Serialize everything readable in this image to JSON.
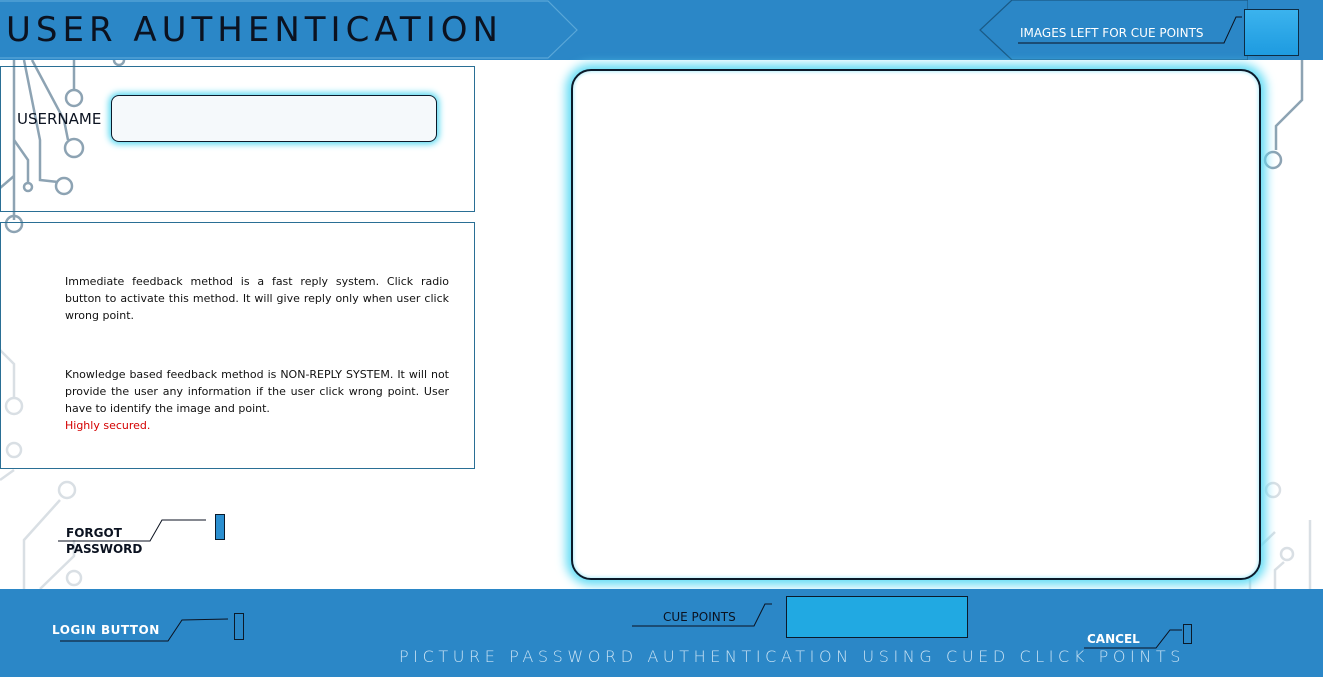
{
  "header": {
    "title": "USER AUTHENTICATION",
    "images_left_label": "IMAGES LEFT FOR CUE POINTS"
  },
  "login_form": {
    "username_label": "USERNAME",
    "username_value": ""
  },
  "info": {
    "immediate_feedback": "Immediate feedback method is a fast reply system. Click radio button to activate this method. It will give reply only when user click wrong point.",
    "knowledge_feedback": "Knowledge based feedback method is NON-REPLY SYSTEM. It will not provide the user any information if the user click wrong point. User  have to identify the image and point.",
    "highlight": "Highly secured."
  },
  "forgot_password": {
    "label": "FORGOT\nPASSWORD"
  },
  "footer": {
    "login_label": "LOGIN  BUTTON",
    "cue_points_label": "CUE POINTS",
    "cancel_label": "CANCEL",
    "caption": "PICTURE PASSWORD AUTHENTICATION USING CUED CLICK POINTS"
  },
  "colors": {
    "header_blue": "#2b87c7",
    "glow_cyan": "#62dcf5",
    "highlight_red": "#d40000",
    "cue_box": "#21a9e2"
  }
}
